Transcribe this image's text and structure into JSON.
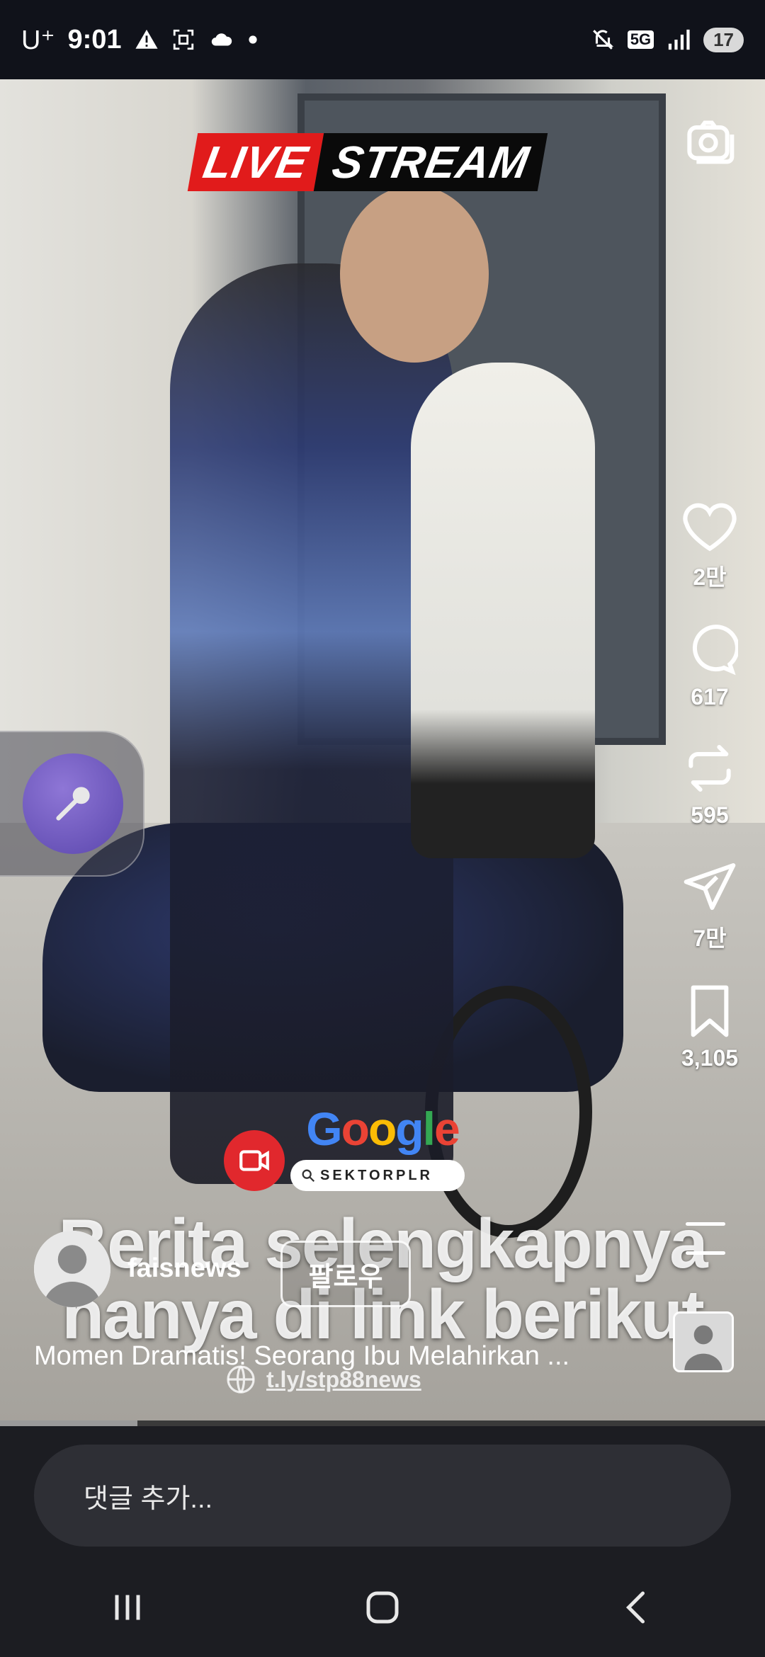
{
  "status_bar": {
    "carrier": "U⁺",
    "time": "9:01",
    "network": "5G",
    "battery": "17"
  },
  "video": {
    "live_badge_left": "LIVE",
    "live_badge_right": "STREAM",
    "promo_brand": "Google",
    "promo_search_text": "SEKTORPLR",
    "overlay_line1": "Berita selengkapnya",
    "overlay_line2": "hanya di link berikut",
    "progress_fraction": 0.18
  },
  "actions": {
    "like_count": "2만",
    "comment_count": "617",
    "repost_count": "595",
    "share_count": "7만",
    "save_count": "3,105"
  },
  "post": {
    "username": "faisnews",
    "follow_label": "팔로우",
    "caption": "Momen Dramatis! Seorang Ibu Melahirkan ...",
    "link": "t.ly/stp88news"
  },
  "comment": {
    "placeholder": "댓글 추가..."
  },
  "icons": [
    "camera-icon",
    "heart-icon",
    "comment-icon",
    "repost-icon",
    "share-icon",
    "bookmark-icon",
    "microphone-icon",
    "video-call-icon",
    "globe-icon",
    "menu-icon",
    "recent-apps-icon",
    "home-icon",
    "back-icon"
  ]
}
